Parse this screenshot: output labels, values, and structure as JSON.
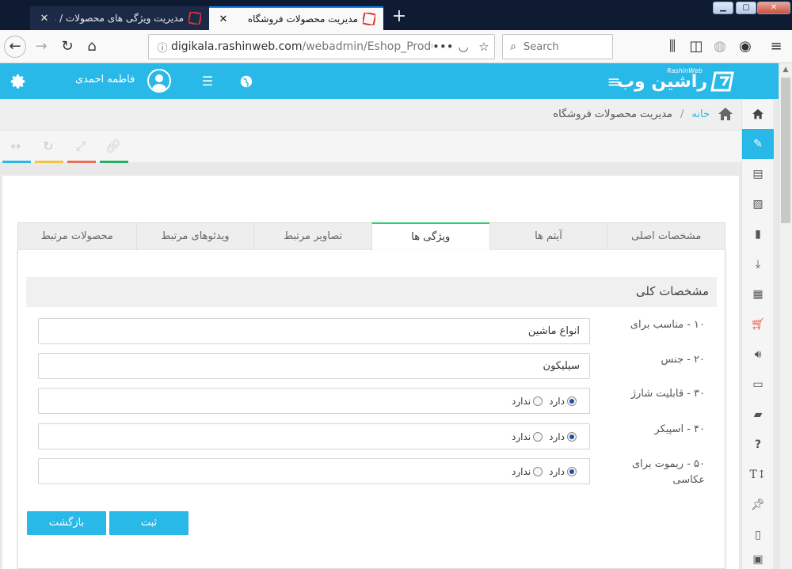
{
  "browser": {
    "tabs": [
      {
        "title": "مدیریت ویژگی های محصولات / مدیر",
        "active": false
      },
      {
        "title": "مدیریت محصولات فروشگاه",
        "active": true
      }
    ],
    "url_host": "digikala.rashinweb.com",
    "url_path": "/webadmin/Eshop_Produ",
    "search_placeholder": "Search",
    "icons": {
      "back": "arrow-left-icon",
      "forward": "arrow-right-icon",
      "reload": "reload-icon",
      "home": "home-icon",
      "more": "ellipsis-icon",
      "pocket": "pocket-icon",
      "bookmark": "star-icon",
      "library": "library-icon",
      "sidebar": "sidebar-icon",
      "globe": "globe-icon",
      "account": "account-icon",
      "menu": "hamburger-icon"
    }
  },
  "header": {
    "brand": "راشین وب",
    "brand_sub": "RashinWeb",
    "username": "فاطمه احمدی",
    "accent": "#29b9e8"
  },
  "breadcrumb": {
    "home": "خانه",
    "separator": "/",
    "current": "مدیریت محصولات فروشگاه"
  },
  "toolstrip": {
    "tools": [
      {
        "icon": "link-icon",
        "color": "#27ae60"
      },
      {
        "icon": "expand-icon",
        "color": "#e8705a"
      },
      {
        "icon": "refresh-icon",
        "color": "#f5c342"
      },
      {
        "icon": "resize-horizontal-icon",
        "color": "#29b9e8"
      }
    ]
  },
  "tabs": [
    {
      "label": "مشخصات اصلی",
      "active": false
    },
    {
      "label": "آیتم ها",
      "active": false
    },
    {
      "label": "ویژگی ها",
      "active": true
    },
    {
      "label": "تصاویر مرتبط",
      "active": false
    },
    {
      "label": "ویدئوهای مرتبط",
      "active": false
    },
    {
      "label": "محصولات مرتبط",
      "active": false
    }
  ],
  "section": {
    "title": "مشخصات کلی"
  },
  "fields": [
    {
      "label": "۱۰ - مناسب برای",
      "type": "text",
      "value": "انواع ماشین"
    },
    {
      "label": "۲۰ - جنس",
      "type": "text",
      "value": "سیلیکون"
    },
    {
      "label": "۳۰ - قابلیت شارژ",
      "type": "radio",
      "options": [
        "دارد",
        "ندارد"
      ],
      "selected": "دارد"
    },
    {
      "label": "۴۰ - اسپیکر",
      "type": "radio",
      "options": [
        "دارد",
        "ندارد"
      ],
      "selected": "دارد"
    },
    {
      "label": "۵۰ - ریموت برای عکاسی",
      "type": "radio",
      "options": [
        "دارد",
        "ندارد"
      ],
      "selected": "دارد"
    }
  ],
  "actions": {
    "submit": "ثبت",
    "back": "بازگشت"
  },
  "sidebar": {
    "items": [
      "home-icon",
      "edit-icon",
      "news-icon",
      "image-icon",
      "file-icon",
      "download-icon",
      "film-icon",
      "cart-icon",
      "volume-icon",
      "monitor-icon",
      "book-icon",
      "question-icon",
      "text-height-icon",
      "pin-icon",
      "document-icon",
      "excel-icon"
    ],
    "active_index": 1
  }
}
